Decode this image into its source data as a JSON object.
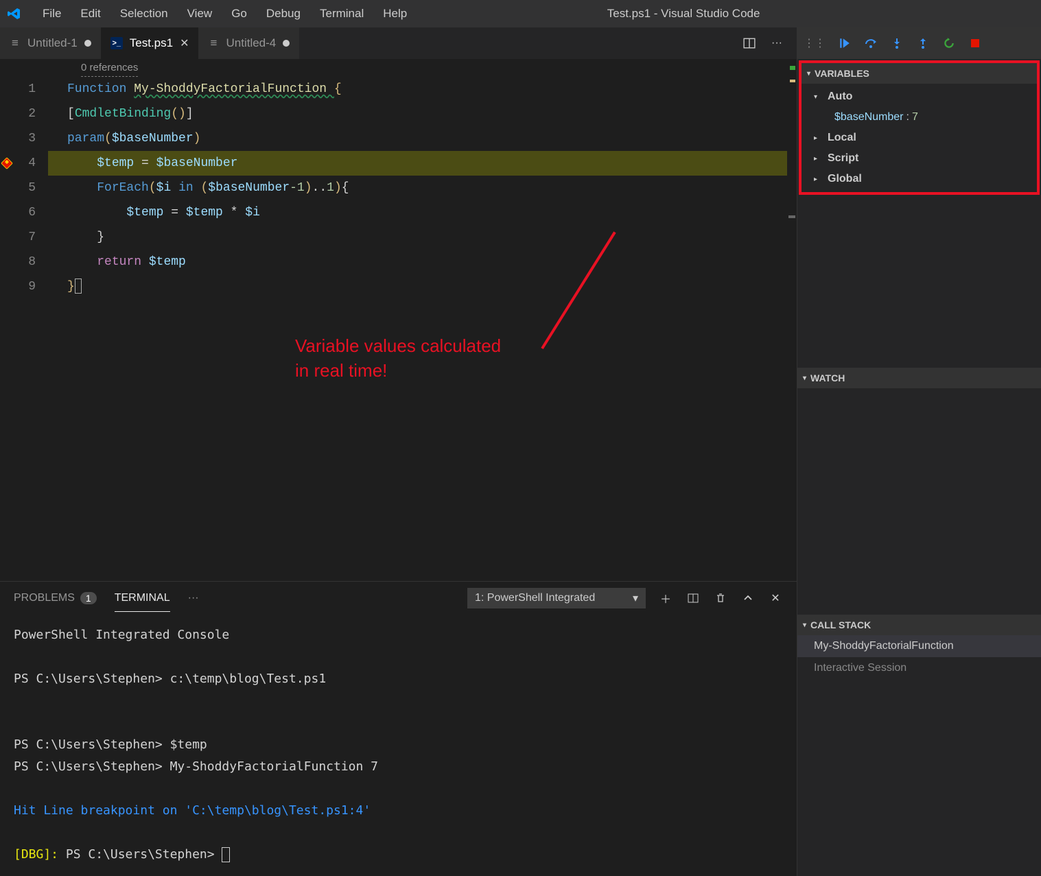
{
  "window": {
    "title": "Test.ps1 - Visual Studio Code"
  },
  "menu": [
    "File",
    "Edit",
    "Selection",
    "View",
    "Go",
    "Debug",
    "Terminal",
    "Help"
  ],
  "tabs": [
    {
      "label": "Untitled-1",
      "icon": "file",
      "dirty": true,
      "active": false
    },
    {
      "label": "Test.ps1",
      "icon": "powershell",
      "dirty": false,
      "active": true
    },
    {
      "label": "Untitled-4",
      "icon": "file",
      "dirty": true,
      "active": false
    }
  ],
  "editor": {
    "codelens": "0 references",
    "lines": [
      "1",
      "2",
      "3",
      "4",
      "5",
      "6",
      "7",
      "8",
      "9"
    ]
  },
  "code": {
    "l1": {
      "fn": "Function ",
      "name": "My-ShoddyFactorialFunction ",
      "brace": "{"
    },
    "l2": {
      "open": "[",
      "cmd": "CmdletBinding",
      "paren": "()",
      "close": "]"
    },
    "l3": {
      "kw": "param",
      "open": "(",
      "var": "$baseNumber",
      "close": ")"
    },
    "l4": {
      "indent": "    ",
      "var": "$temp",
      "eq": " = ",
      "rhs": "$baseNumber"
    },
    "l5": {
      "indent": "    ",
      "kw": "ForEach",
      "open": "(",
      "iv": "$i",
      "in": " in ",
      "po": "(",
      "bn": "$baseNumber",
      "m1": "-1",
      "pc": ")",
      "range": "..",
      "one": "1",
      "close": ")",
      "brace": "{"
    },
    "l6": {
      "indent": "        ",
      "var": "$temp",
      "eq": " = ",
      "a": "$temp",
      "star": " * ",
      "b": "$i"
    },
    "l7": {
      "indent": "    ",
      "brace": "}"
    },
    "l8": {
      "indent": "    ",
      "kw": "return ",
      "var": "$temp"
    },
    "l9": {
      "brace": "}"
    }
  },
  "annotation": {
    "line1": "Variable values calculated",
    "line2": "in real time!"
  },
  "panel": {
    "problems": "PROBLEMS",
    "problems_count": "1",
    "terminal": "TERMINAL",
    "more": "···",
    "selector": "1: PowerShell Integrated"
  },
  "terminal": {
    "l1": "PowerShell Integrated Console",
    "l2": "PS C:\\Users\\Stephen> c:\\temp\\blog\\Test.ps1",
    "l3": "PS C:\\Users\\Stephen> $temp",
    "l4": "PS C:\\Users\\Stephen> My-ShoddyFactorialFunction 7",
    "l5": "Hit Line breakpoint on 'C:\\temp\\blog\\Test.ps1:4'",
    "l6a": "[DBG]: ",
    "l6b": "PS C:\\Users\\Stephen> "
  },
  "debug": {
    "variables": "VARIABLES",
    "auto": "Auto",
    "var_name": "$baseNumber",
    "var_val": "7",
    "local": "Local",
    "script": "Script",
    "global": "Global",
    "watch": "WATCH",
    "callstack": "CALL STACK",
    "cs1": "My-ShoddyFactorialFunction",
    "cs2": "Interactive Session"
  }
}
